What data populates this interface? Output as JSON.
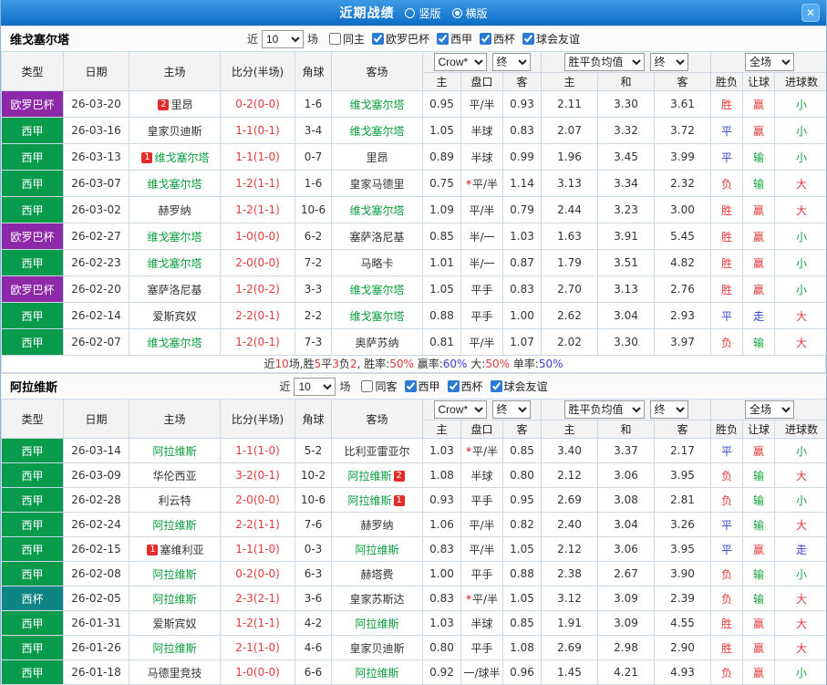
{
  "titlebar": {
    "title": "近期战绩",
    "view_options": [
      {
        "label": "竖版",
        "selected": false
      },
      {
        "label": "横版",
        "selected": true
      }
    ],
    "close_label": "✕"
  },
  "colors": {
    "red": "#e23b3b",
    "blue": "#3344cc",
    "green": "#12a33c",
    "dark": "#333333"
  },
  "type_colors": {
    "欧罗巴杯": "#8d28a8",
    "西甲": "#089b4b",
    "西杯": "#0e8585"
  },
  "table_header": {
    "cols": [
      "类型",
      "日期",
      "主场",
      "比分(半场)",
      "角球",
      "客场"
    ],
    "company_select": "Crow*",
    "final_select": "终",
    "avg_select": "胜平负均值",
    "final_select2": "终",
    "scope_select": "全场",
    "sub": [
      "主",
      "盘口",
      "客",
      "主",
      "和",
      "客",
      "胜负",
      "让球",
      "进球数"
    ]
  },
  "sections": [
    {
      "team": "维戈塞尔塔",
      "filter": {
        "near_label": "近",
        "count": "10",
        "games_label": "场",
        "checkboxes": [
          {
            "label": "同主",
            "checked": false
          },
          {
            "label": "欧罗巴杯",
            "checked": true
          },
          {
            "label": "西甲",
            "checked": true
          },
          {
            "label": "西杯",
            "checked": true
          },
          {
            "label": "球会友谊",
            "checked": true
          }
        ]
      },
      "rows": [
        {
          "type": "欧罗巴杯",
          "date": "26-03-20",
          "home": {
            "pre": "2",
            "name": "里昂"
          },
          "score": "0-2(0-0)",
          "corner": "1-6",
          "away": {
            "name": "维戈塞尔塔",
            "tracked": true
          },
          "h": "0.95",
          "hcp": "平/半",
          "a": "0.93",
          "m1": "2.11",
          "m2": "3.30",
          "m3": "3.61",
          "wdl": "胜",
          "wdlc": "red",
          "hr": "赢",
          "hrc": "red",
          "ou": "小",
          "ouc": "green"
        },
        {
          "type": "西甲",
          "date": "26-03-16",
          "home": {
            "name": "皇家贝迪斯"
          },
          "score": "1-1(0-1)",
          "corner": "3-4",
          "away": {
            "name": "维戈塞尔塔",
            "tracked": true
          },
          "h": "1.05",
          "hcp": "半球",
          "a": "0.83",
          "m1": "2.07",
          "m2": "3.32",
          "m3": "3.72",
          "wdl": "平",
          "wdlc": "blue",
          "hr": "赢",
          "hrc": "red",
          "ou": "小",
          "ouc": "green"
        },
        {
          "type": "西甲",
          "date": "26-03-13",
          "home": {
            "pre": "1",
            "name": "维戈塞尔塔",
            "tracked": true
          },
          "score": "1-1(1-0)",
          "corner": "0-7",
          "away": {
            "name": "里昂"
          },
          "h": "0.89",
          "hcp": "半球",
          "a": "0.99",
          "m1": "1.96",
          "m2": "3.45",
          "m3": "3.99",
          "wdl": "平",
          "wdlc": "blue",
          "hr": "输",
          "hrc": "green",
          "ou": "小",
          "ouc": "green"
        },
        {
          "type": "西甲",
          "date": "26-03-07",
          "home": {
            "name": "维戈塞尔塔",
            "tracked": true
          },
          "score": "1-2(1-1)",
          "corner": "1-6",
          "away": {
            "name": "皇家马德里"
          },
          "h": "0.75",
          "star": true,
          "hcp": "平/半",
          "a": "1.14",
          "m1": "3.13",
          "m2": "3.34",
          "m3": "2.32",
          "wdl": "负",
          "wdlc": "red",
          "hr": "输",
          "hrc": "green",
          "ou": "大",
          "ouc": "red"
        },
        {
          "type": "西甲",
          "date": "26-03-02",
          "home": {
            "name": "赫罗纳"
          },
          "score": "1-2(1-1)",
          "corner": "10-6",
          "away": {
            "name": "维戈塞尔塔",
            "tracked": true
          },
          "h": "1.09",
          "hcp": "平/半",
          "a": "0.79",
          "m1": "2.44",
          "m2": "3.23",
          "m3": "3.00",
          "wdl": "胜",
          "wdlc": "red",
          "hr": "赢",
          "hrc": "red",
          "ou": "大",
          "ouc": "red"
        },
        {
          "type": "欧罗巴杯",
          "date": "26-02-27",
          "home": {
            "name": "维戈塞尔塔",
            "tracked": true
          },
          "score": "1-0(0-0)",
          "corner": "6-2",
          "away": {
            "name": "塞萨洛尼基"
          },
          "h": "0.85",
          "hcp": "半/一",
          "a": "1.03",
          "m1": "1.63",
          "m2": "3.91",
          "m3": "5.45",
          "wdl": "胜",
          "wdlc": "red",
          "hr": "赢",
          "hrc": "red",
          "ou": "小",
          "ouc": "green"
        },
        {
          "type": "西甲",
          "date": "26-02-23",
          "home": {
            "name": "维戈塞尔塔",
            "tracked": true
          },
          "score": "2-0(0-0)",
          "corner": "7-2",
          "away": {
            "name": "马略卡"
          },
          "h": "1.01",
          "hcp": "半/一",
          "a": "0.87",
          "m1": "1.79",
          "m2": "3.51",
          "m3": "4.82",
          "wdl": "胜",
          "wdlc": "red",
          "hr": "赢",
          "hrc": "red",
          "ou": "小",
          "ouc": "green"
        },
        {
          "type": "欧罗巴杯",
          "date": "26-02-20",
          "home": {
            "name": "塞萨洛尼基"
          },
          "score": "1-2(0-2)",
          "corner": "3-3",
          "away": {
            "name": "维戈塞尔塔",
            "tracked": true
          },
          "h": "1.05",
          "hcp": "平手",
          "a": "0.83",
          "m1": "2.70",
          "m2": "3.13",
          "m3": "2.76",
          "wdl": "胜",
          "wdlc": "red",
          "hr": "赢",
          "hrc": "red",
          "ou": "小",
          "ouc": "green"
        },
        {
          "type": "西甲",
          "date": "26-02-14",
          "home": {
            "name": "爱斯宾奴"
          },
          "score": "2-2(0-1)",
          "corner": "2-2",
          "away": {
            "name": "维戈塞尔塔",
            "tracked": true
          },
          "h": "0.88",
          "hcp": "平手",
          "a": "1.00",
          "m1": "2.62",
          "m2": "3.04",
          "m3": "2.93",
          "wdl": "平",
          "wdlc": "blue",
          "hr": "走",
          "hrc": "blue",
          "ou": "大",
          "ouc": "red"
        },
        {
          "type": "西甲",
          "date": "26-02-07",
          "home": {
            "name": "维戈塞尔塔",
            "tracked": true
          },
          "score": "1-2(0-1)",
          "corner": "7-3",
          "away": {
            "name": "奥萨苏纳"
          },
          "h": "0.81",
          "hcp": "平/半",
          "a": "1.07",
          "m1": "2.02",
          "m2": "3.30",
          "m3": "3.97",
          "wdl": "负",
          "wdlc": "red",
          "hr": "输",
          "hrc": "green",
          "ou": "大",
          "ouc": "red"
        }
      ],
      "summary": [
        {
          "t": "近",
          "c": "dark"
        },
        {
          "t": "10",
          "c": "red"
        },
        {
          "t": "场,胜",
          "c": "dark"
        },
        {
          "t": "5",
          "c": "red"
        },
        {
          "t": "平",
          "c": "dark"
        },
        {
          "t": "3",
          "c": "red"
        },
        {
          "t": "负",
          "c": "dark"
        },
        {
          "t": "2",
          "c": "red"
        },
        {
          "t": ", 胜率:",
          "c": "dark"
        },
        {
          "t": "50%",
          "c": "red"
        },
        {
          "t": " 赢率:",
          "c": "dark"
        },
        {
          "t": "60%",
          "c": "blue"
        },
        {
          "t": " 大:",
          "c": "dark"
        },
        {
          "t": "50%",
          "c": "red"
        },
        {
          "t": " 单率:",
          "c": "dark"
        },
        {
          "t": "50%",
          "c": "blue"
        }
      ]
    },
    {
      "team": "阿拉维斯",
      "filter": {
        "near_label": "近",
        "count": "10",
        "games_label": "场",
        "checkboxes": [
          {
            "label": "同客",
            "checked": false
          },
          {
            "label": "西甲",
            "checked": true
          },
          {
            "label": "西杯",
            "checked": true
          },
          {
            "label": "球会友谊",
            "checked": true
          }
        ]
      },
      "rows": [
        {
          "type": "西甲",
          "date": "26-03-14",
          "home": {
            "name": "阿拉维斯",
            "tracked": true
          },
          "score": "1-1(1-0)",
          "corner": "5-2",
          "away": {
            "name": "比利亚雷亚尔"
          },
          "h": "1.03",
          "star": true,
          "hcp": "平/半",
          "a": "0.85",
          "m1": "3.40",
          "m2": "3.37",
          "m3": "2.17",
          "wdl": "平",
          "wdlc": "blue",
          "hr": "赢",
          "hrc": "red",
          "ou": "小",
          "ouc": "green"
        },
        {
          "type": "西甲",
          "date": "26-03-09",
          "home": {
            "name": "华伦西亚"
          },
          "score": "3-2(0-1)",
          "corner": "10-2",
          "away": {
            "name": "阿拉维斯",
            "tracked": true,
            "post": "2"
          },
          "h": "1.08",
          "hcp": "半球",
          "a": "0.80",
          "m1": "2.12",
          "m2": "3.06",
          "m3": "3.95",
          "wdl": "负",
          "wdlc": "red",
          "hr": "输",
          "hrc": "green",
          "ou": "大",
          "ouc": "red"
        },
        {
          "type": "西甲",
          "date": "26-02-28",
          "home": {
            "name": "利云特"
          },
          "score": "2-0(0-0)",
          "corner": "10-6",
          "away": {
            "name": "阿拉维斯",
            "tracked": true,
            "post": "1"
          },
          "h": "0.93",
          "hcp": "平手",
          "a": "0.95",
          "m1": "2.69",
          "m2": "3.08",
          "m3": "2.81",
          "wdl": "负",
          "wdlc": "red",
          "hr": "输",
          "hrc": "green",
          "ou": "小",
          "ouc": "green"
        },
        {
          "type": "西甲",
          "date": "26-02-24",
          "home": {
            "name": "阿拉维斯",
            "tracked": true
          },
          "score": "2-2(1-1)",
          "corner": "7-6",
          "away": {
            "name": "赫罗纳"
          },
          "h": "1.06",
          "hcp": "平/半",
          "a": "0.82",
          "m1": "2.40",
          "m2": "3.04",
          "m3": "3.26",
          "wdl": "平",
          "wdlc": "blue",
          "hr": "输",
          "hrc": "green",
          "ou": "大",
          "ouc": "red"
        },
        {
          "type": "西甲",
          "date": "26-02-15",
          "home": {
            "pre": "1",
            "name": "塞维利亚"
          },
          "score": "1-1(1-0)",
          "corner": "0-3",
          "away": {
            "name": "阿拉维斯",
            "tracked": true
          },
          "h": "0.83",
          "hcp": "平/半",
          "a": "1.05",
          "m1": "2.12",
          "m2": "3.06",
          "m3": "3.95",
          "wdl": "平",
          "wdlc": "blue",
          "hr": "赢",
          "hrc": "red",
          "ou": "走",
          "ouc": "blue"
        },
        {
          "type": "西甲",
          "date": "26-02-08",
          "home": {
            "name": "阿拉维斯",
            "tracked": true
          },
          "score": "0-2(0-0)",
          "corner": "6-3",
          "away": {
            "name": "赫塔费"
          },
          "h": "1.00",
          "hcp": "平手",
          "a": "0.88",
          "m1": "2.38",
          "m2": "2.67",
          "m3": "3.90",
          "wdl": "负",
          "wdlc": "red",
          "hr": "输",
          "hrc": "green",
          "ou": "小",
          "ouc": "green"
        },
        {
          "type": "西杯",
          "date": "26-02-05",
          "home": {
            "name": "阿拉维斯",
            "tracked": true
          },
          "score": "2-3(2-1)",
          "corner": "3-6",
          "away": {
            "name": "皇家苏斯达"
          },
          "h": "0.83",
          "star": true,
          "hcp": "平/半",
          "a": "1.05",
          "m1": "3.12",
          "m2": "3.09",
          "m3": "2.39",
          "wdl": "负",
          "wdlc": "red",
          "hr": "输",
          "hrc": "green",
          "ou": "大",
          "ouc": "red"
        },
        {
          "type": "西甲",
          "date": "26-01-31",
          "home": {
            "name": "爱斯宾奴"
          },
          "score": "1-2(1-1)",
          "corner": "4-2",
          "away": {
            "name": "阿拉维斯",
            "tracked": true
          },
          "h": "1.03",
          "hcp": "半球",
          "a": "0.85",
          "m1": "1.91",
          "m2": "3.09",
          "m3": "4.55",
          "wdl": "胜",
          "wdlc": "red",
          "hr": "赢",
          "hrc": "red",
          "ou": "大",
          "ouc": "red"
        },
        {
          "type": "西甲",
          "date": "26-01-26",
          "home": {
            "name": "阿拉维斯",
            "tracked": true
          },
          "score": "2-1(1-0)",
          "corner": "4-6",
          "away": {
            "name": "皇家贝迪斯"
          },
          "h": "0.80",
          "hcp": "平手",
          "a": "1.08",
          "m1": "2.69",
          "m2": "2.98",
          "m3": "2.90",
          "wdl": "胜",
          "wdlc": "red",
          "hr": "赢",
          "hrc": "red",
          "ou": "大",
          "ouc": "red"
        },
        {
          "type": "西甲",
          "date": "26-01-18",
          "home": {
            "name": "马德里竞技"
          },
          "score": "1-0(0-0)",
          "corner": "6-6",
          "away": {
            "name": "阿拉维斯",
            "tracked": true
          },
          "h": "0.92",
          "hcp": "一/球半",
          "a": "0.96",
          "m1": "1.45",
          "m2": "4.21",
          "m3": "4.93",
          "wdl": "负",
          "wdlc": "red",
          "hr": "赢",
          "hrc": "red",
          "ou": "小",
          "ouc": "green"
        }
      ]
    }
  ]
}
